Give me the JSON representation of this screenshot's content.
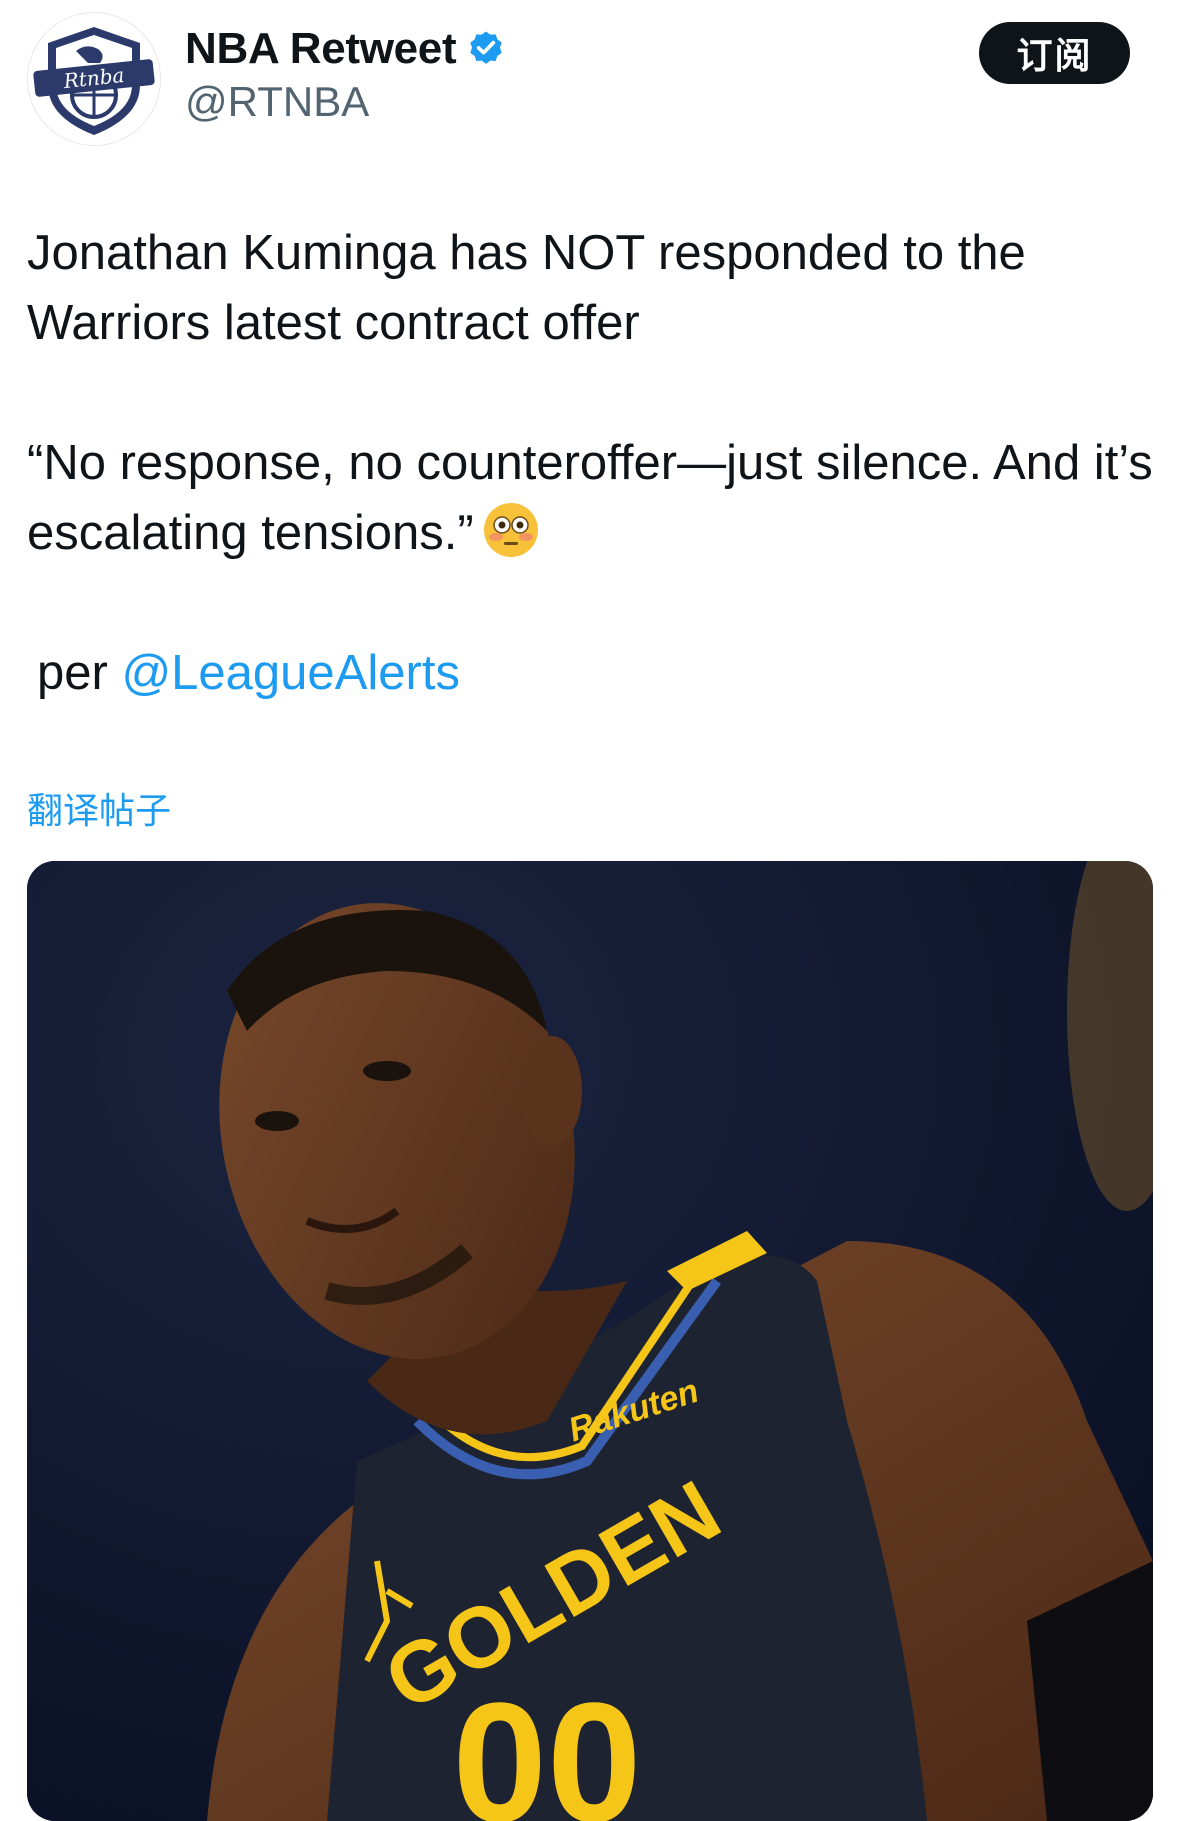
{
  "header": {
    "avatar_icon": "rtnba-logo-icon",
    "avatar_text": "Rtnba",
    "display_name": "NBA Retweet",
    "verified_icon": "verified-badge-icon",
    "handle": "@RTNBA",
    "subscribe_label": "订阅"
  },
  "tweet": {
    "para1": "Jonathan Kuminga has NOT responded to the Warriors latest contract offer",
    "para2": "“No response, no counteroffer—just silence. And it’s escalating tensions.”",
    "emoji_icon": "flushed-face-emoji-icon",
    "para3_prefix": "per ",
    "mention": "@LeagueAlerts",
    "translate_label": "翻译帖子"
  },
  "media": {
    "jersey_sponsor": "Rakuten",
    "jersey_team": "GOLDEN",
    "jersey_number": "00",
    "colors": {
      "background": "#101a33",
      "jersey": "#1d2330",
      "gold": "#f5c518",
      "skin": "#6b3f26"
    }
  },
  "colors": {
    "link": "#1d9bf0",
    "text": "#0f1419",
    "secondary": "#536471",
    "button_bg": "#0f1419"
  }
}
